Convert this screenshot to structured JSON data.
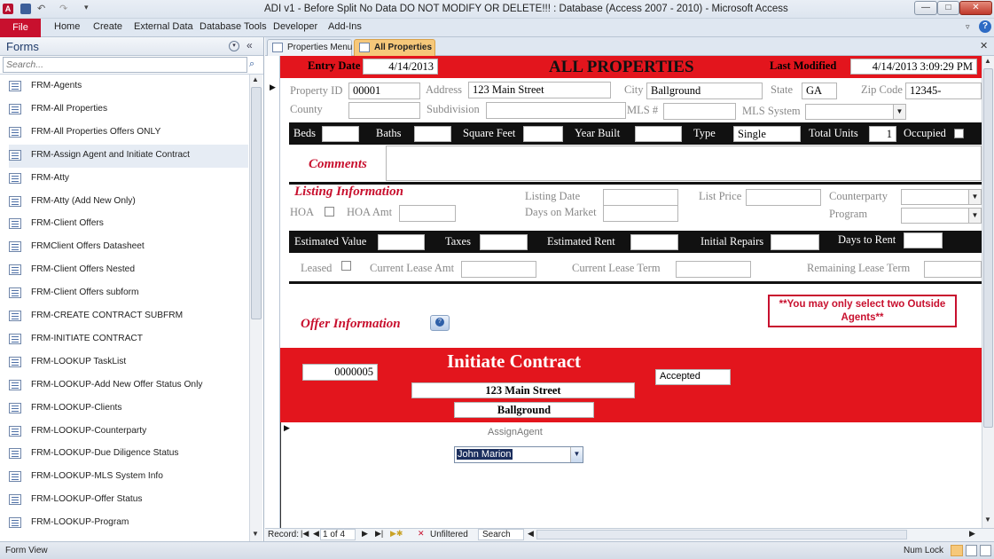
{
  "window": {
    "title": "ADI v1 - Before Split No Data DO NOT MODIFY OR DELETE!!! : Database (Access 2007 - 2010)  -  Microsoft Access",
    "min_label": "—",
    "max_label": "□",
    "close_label": "✕"
  },
  "ribbon": {
    "tabs": [
      "File",
      "Home",
      "Create",
      "External Data",
      "Database Tools",
      "Developer",
      "Add-Ins"
    ],
    "help": "?"
  },
  "nav_pane": {
    "title": "Forms",
    "search_placeholder": "Search...",
    "items": [
      "FRM-Agents",
      "FRM-All Properties",
      "FRM-All Properties Offers ONLY",
      "FRM-Assign Agent and Initiate Contract",
      "FRM-Atty",
      "FRM-Atty (Add New Only)",
      "FRM-Client Offers",
      "FRMClient Offers Datasheet",
      "FRM-Client Offers Nested",
      "FRM-Client Offers subform",
      "FRM-CREATE CONTRACT SUBFRM",
      "FRM-INITIATE CONTRACT",
      "FRM-LOOKUP TaskList",
      "FRM-LOOKUP-Add New Offer Status Only",
      "FRM-LOOKUP-Clients",
      "FRM-LOOKUP-Counterparty",
      "FRM-LOOKUP-Due Diligence Status",
      "FRM-LOOKUP-MLS System Info",
      "FRM-LOOKUP-Offer Status",
      "FRM-LOOKUP-Program"
    ],
    "selected_index": 3
  },
  "doc_tabs": [
    "Properties Menu",
    "All Properties"
  ],
  "form": {
    "entry_date_label": "Entry Date",
    "entry_date": "4/14/2013",
    "title": "ALL PROPERTIES",
    "last_modified_label": "Last Modified",
    "last_modified": "4/14/2013 3:09:29 PM",
    "property_id_label": "Property ID",
    "property_id": "00001",
    "address_label": "Address",
    "address": "123 Main Street",
    "city_label": "City",
    "city": "Ballground",
    "state_label": "State",
    "state": "GA",
    "zip_label": "Zip Code",
    "zip": "12345-",
    "county_label": "County",
    "subdivision_label": "Subdivision",
    "mls_label": "MLS #",
    "mls_system_label": "MLS System",
    "beds_label": "Beds",
    "baths_label": "Baths",
    "sqft_label": "Square Feet",
    "year_built_label": "Year Built",
    "type_label": "Type",
    "type": "Single",
    "total_units_label": "Total Units",
    "total_units": "1",
    "occupied_label": "Occupied",
    "comments_label": "Comments",
    "listing_info_label": "Listing Information",
    "listing_date_label": "Listing Date",
    "list_price_label": "List Price",
    "counterparty_label": "Counterparty",
    "hoa_label": "HOA",
    "hoa_amt_label": "HOA Amt",
    "days_on_market_label": "Days on Market",
    "program_label": "Program",
    "est_value_label": "Estimated Value",
    "taxes_label": "Taxes",
    "est_rent_label": "Estimated Rent",
    "initial_repairs_label": "Initial Repairs",
    "days_to_rent_label": "Days to Rent",
    "leased_label": "Leased",
    "current_lease_amt_label": "Current Lease Amt",
    "current_lease_term_label": "Current Lease Term",
    "remaining_lease_term_label": "Remaining Lease Term",
    "offer_info_label": "Offer Information",
    "agents_note": "**You may only select two Outside Agents**",
    "contract_title": "Initiate Contract",
    "contract_id": "0000005",
    "contract_status": "Accepted",
    "contract_address": "123 Main Street",
    "contract_city": "Ballground",
    "assign_agent_label": "AssignAgent",
    "assign_agent_value": "John Marion"
  },
  "record_nav": {
    "label": "Record:",
    "position": "1 of 4",
    "filter": "Unfiltered",
    "search": "Search"
  },
  "status_bar": {
    "left": "Form View",
    "right": "Num Lock"
  }
}
